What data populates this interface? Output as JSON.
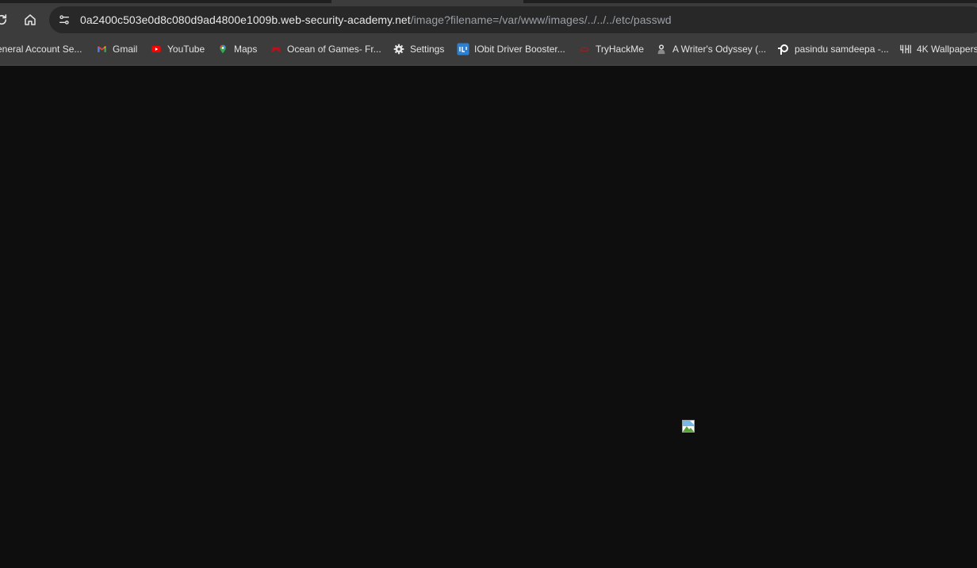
{
  "toolbar": {
    "url_host": "0a2400c503e0d8c080d9ad4800e1009b.web-security-academy.net",
    "url_path": "/image?filename=/var/www/images/../../../etc/passwd"
  },
  "bookmarks": [
    {
      "label": "eneral Account Se...",
      "icon": "account-icon"
    },
    {
      "label": "Gmail",
      "icon": "gmail-icon"
    },
    {
      "label": "YouTube",
      "icon": "youtube-icon"
    },
    {
      "label": "Maps",
      "icon": "maps-icon"
    },
    {
      "label": "Ocean of Games- Fr...",
      "icon": "gamepad-icon"
    },
    {
      "label": "Settings",
      "icon": "gear-icon"
    },
    {
      "label": "IObit Driver Booster...",
      "icon": "iobit-icon"
    },
    {
      "label": "TryHackMe",
      "icon": "tryhackme-icon"
    },
    {
      "label": "A Writer's Odyssey (...",
      "icon": "movie-icon"
    },
    {
      "label": "pasindu samdeepa -...",
      "icon": "pasindu-icon"
    },
    {
      "label": "4K Wallpapers",
      "icon": "wallpapers-icon"
    }
  ],
  "colors": {
    "page_background": "#0e0e0e",
    "toolbar": "#3c3c3c",
    "omnibox": "#282828"
  }
}
